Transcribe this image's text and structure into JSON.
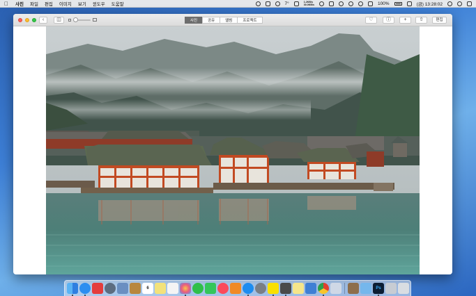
{
  "menubar": {
    "apple_icon": "apple-icon",
    "items": [
      "사진",
      "파일",
      "편집",
      "이미지",
      "보기",
      "윈도우",
      "도움말"
    ],
    "temperature": "7°",
    "net_up": "1.2KB/s",
    "net_down": "30.0KB/s",
    "battery_percent": "100%",
    "clock": "(금) 13:28:02"
  },
  "window": {
    "tabs": [
      "사진",
      "공유",
      "앨범",
      "프로젝트"
    ],
    "active_tab": "사진",
    "edit_label": "편집",
    "zoom_level": 0.0
  },
  "dock": {
    "apps": [
      "finder",
      "safari",
      "photo-booth",
      "launchpad",
      "preview",
      "notes-book",
      "calendar",
      "stickies",
      "reminders",
      "photos",
      "messages",
      "facetime",
      "music",
      "books",
      "app-store",
      "system-preferences",
      "kakaotalk",
      "sublime-text",
      "notes",
      "keynote",
      "chrome",
      "preview-2",
      "downloads-stack",
      "folder",
      "photoshop",
      "documents-stack",
      "trash"
    ],
    "calendar_day": "6"
  },
  "colors": {
    "menubar": "#ececec",
    "active_segment": "#6d6d6d",
    "traffic_red": "#fc5f57",
    "traffic_yellow": "#fdbc2e",
    "traffic_green": "#33c748"
  }
}
